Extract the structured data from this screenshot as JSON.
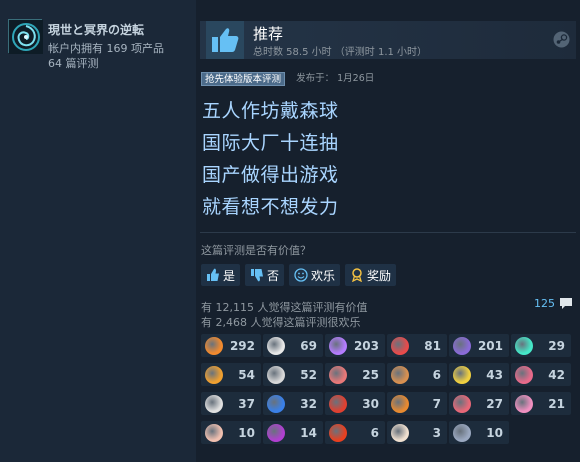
{
  "profile": {
    "name": "現世と冥界の逆転",
    "products": "帐户内拥有 169 项产品",
    "reviews": "64 篇评测"
  },
  "review": {
    "verdict": "推荐",
    "hours": "总时数 58.5 小时 （评测时 1.1 小时）",
    "early_access_badge": "抢先体验版本评测",
    "posted": "发布于： 1月26日",
    "lines": [
      "五人作坊戴森球",
      "国际大厂十连抽",
      "国产做得出游戏",
      "就看想不想发力"
    ]
  },
  "feedback": {
    "question": "这篇评测是否有价值？",
    "yes": "是",
    "no": "否",
    "funny": "欢乐",
    "award": "奖励",
    "helpful_count": "有 12,115 人觉得这篇评测有价值",
    "funny_count": "有 2,468 人觉得这篇评测很欢乐",
    "comments": "125"
  },
  "awards": [
    {
      "icon": "fire-gun-icon",
      "count": "292",
      "color": "#f28a2e"
    },
    {
      "icon": "cow-icon",
      "count": "69",
      "color": "#e8e8e8"
    },
    {
      "icon": "crown-icon",
      "count": "203",
      "color": "#b47cff"
    },
    {
      "icon": "potion-icon",
      "count": "81",
      "color": "#e84b4b"
    },
    {
      "icon": "horse-icon",
      "count": "201",
      "color": "#8a6bd8"
    },
    {
      "icon": "comet-icon",
      "count": "29",
      "color": "#45e8c8"
    },
    {
      "icon": "laugh-icon",
      "count": "54",
      "color": "#f0a030"
    },
    {
      "icon": "moon-icon",
      "count": "52",
      "color": "#d8d8d8"
    },
    {
      "icon": "ufo-icon",
      "count": "25",
      "color": "#e87878"
    },
    {
      "icon": "cookie-icon",
      "count": "6",
      "color": "#d89050"
    },
    {
      "icon": "sun-icon",
      "count": "43",
      "color": "#f0d040"
    },
    {
      "icon": "pig-face-icon",
      "count": "42",
      "color": "#e86a8a"
    },
    {
      "icon": "statue-icon",
      "count": "37",
      "color": "#e0e0e0"
    },
    {
      "icon": "gift-icon",
      "count": "32",
      "color": "#3a80e8"
    },
    {
      "icon": "rooster-icon",
      "count": "30",
      "color": "#e04030"
    },
    {
      "icon": "seahorse-icon",
      "count": "7",
      "color": "#e88a30"
    },
    {
      "icon": "pill-icon",
      "count": "27",
      "color": "#e86878"
    },
    {
      "icon": "pig-icon",
      "count": "21",
      "color": "#f090c0"
    },
    {
      "icon": "clown-icon",
      "count": "10",
      "color": "#f0c0b0"
    },
    {
      "icon": "shoe-icon",
      "count": "14",
      "color": "#b040d0"
    },
    {
      "icon": "lion-icon",
      "count": "6",
      "color": "#e84020"
    },
    {
      "icon": "cloud-icon",
      "count": "3",
      "color": "#f0e0d0"
    },
    {
      "icon": "wolf-icon",
      "count": "10",
      "color": "#9aa8c0"
    }
  ],
  "colors": {
    "background": "#1b2838",
    "accent": "#66c0f4",
    "review_text": "#a9d5ff"
  }
}
